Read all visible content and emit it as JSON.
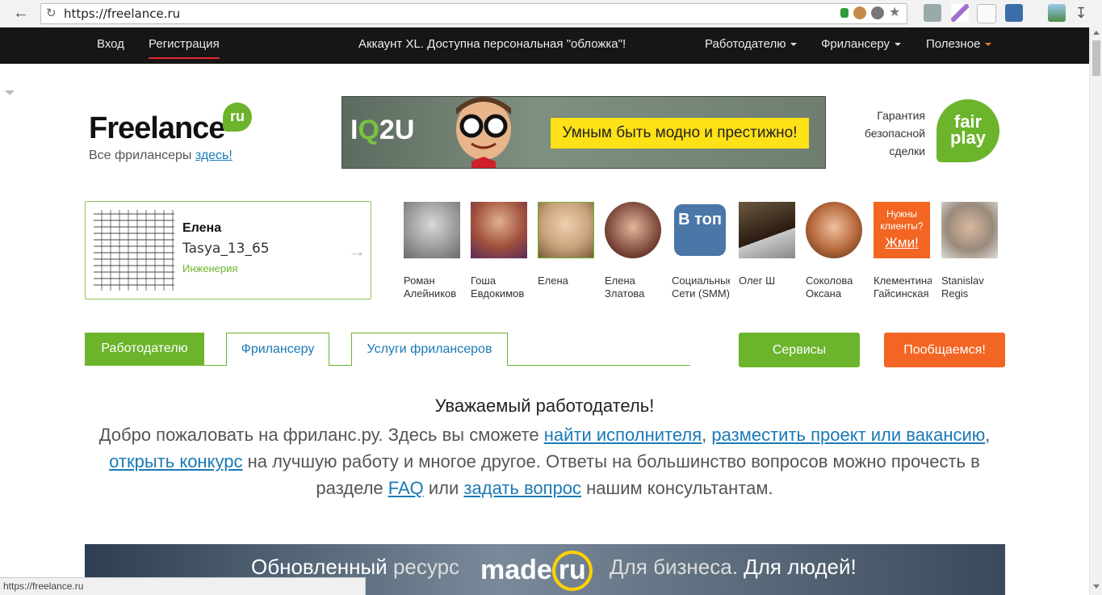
{
  "browser": {
    "url": "https://freelance.ru",
    "status_url": "https://freelance.ru"
  },
  "topnav": {
    "login": "Вход",
    "register": "Регистрация",
    "promo": "Аккаунт XL. Доступна персональная \"обложка\"!",
    "employer": "Работодателю",
    "freelancer": "Фрилансеру",
    "useful": "Полезное"
  },
  "header": {
    "logo": "Freelance",
    "logo_badge": "ru",
    "all_freelancers": "Все фрилансеры ",
    "here_link": "здесь!",
    "banner_brand_1": "I",
    "banner_brand_q": "Q",
    "banner_brand_2": "2U",
    "banner_slogan": "Умным быть модно и престижно!",
    "guarantee_1": "Гарантия",
    "guarantee_2": "безопасной",
    "guarantee_3": "сделки",
    "fair": "fair",
    "play": "play"
  },
  "featured": {
    "name": "Елена",
    "login": "Tasya_13_65",
    "specialty": "Инженерия"
  },
  "avatars": [
    {
      "line1": "Роман",
      "line2": "Алейников",
      "color": "#8a8a8a"
    },
    {
      "line1": "Гоша",
      "line2": "Евдокимов",
      "color": "#a0503c"
    },
    {
      "line1": "Елена",
      "line2": "",
      "color": "#c9a27c"
    },
    {
      "line1": "Елена",
      "line2": "Златова",
      "color": "#6d3a2e"
    },
    {
      "line1": "Социальные",
      "line2": "Сети (SMM)",
      "color": "#4a76a8",
      "tile": "В топ"
    },
    {
      "line1": "Олег Ш",
      "line2": "",
      "color": "#3b2a1a"
    },
    {
      "line1": "Соколова",
      "line2": "Оксана",
      "color": "#b5683a"
    },
    {
      "line1": "Клементина",
      "line2": "Гайсинская",
      "color": "#f26522",
      "tile_1": "Нужны клиенты?",
      "tile_2": "Жми!"
    },
    {
      "line1": "Stanislav",
      "line2": "Regis",
      "color": "#9a8a7a"
    }
  ],
  "tabs": {
    "employer": "Работодателю",
    "freelancer": "Фрилансеру",
    "services_fl": "Услуги фрилансеров"
  },
  "buttons": {
    "services": "Сервисы",
    "chat": "Пообщаемся!"
  },
  "welcome": {
    "title": "Уважаемый работодатель!",
    "t1": "Добро пожаловать на фриланс.ру. Здесь вы сможете ",
    "l1": "найти исполнителя",
    "t2": ", ",
    "l2": "разместить проект или вакансию",
    "t3": ", ",
    "l3": "открыть конкурс",
    "t4": " на лучшую работу и многое другое. Ответы на большинство вопросов можно прочесть в разделе ",
    "l4": "FAQ",
    "t5": " или ",
    "l5": "задать вопрос",
    "t6": " нашим консультантам."
  },
  "bottom_banner": {
    "left_1": "Обновленный",
    "left_2": " ресурс",
    "made": "made",
    "made_ru": "ru",
    "right_1": "Для бизнеса. ",
    "right_2": "Для людей!"
  },
  "colors": {
    "green": "#6bb42b",
    "orange": "#f26522",
    "link": "#1a7ab5",
    "nav": "#161616"
  }
}
